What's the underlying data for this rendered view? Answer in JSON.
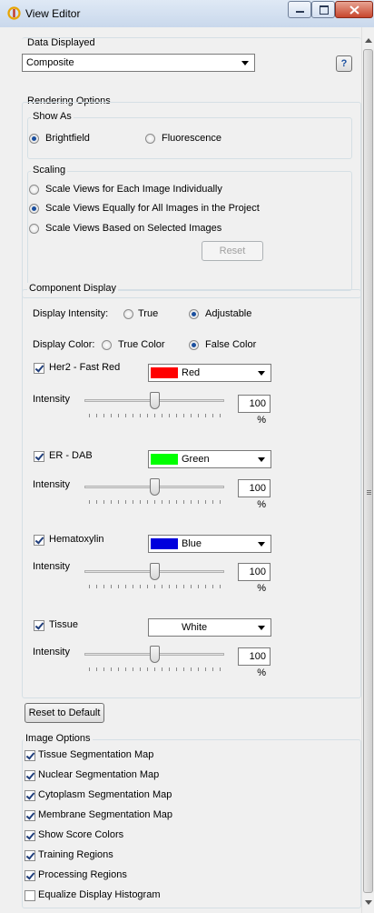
{
  "window": {
    "title": "View Editor"
  },
  "data_displayed": {
    "label": "Data Displayed",
    "selected": "Composite",
    "help_label": "?"
  },
  "rendering_options": {
    "label": "Rendering Options",
    "show_as": {
      "label": "Show As",
      "options": [
        "Brightfield",
        "Fluorescence"
      ],
      "selected": "Brightfield"
    },
    "scaling": {
      "label": "Scaling",
      "options": [
        "Scale Views for Each Image Individually",
        "Scale Views Equally for All Images in the Project",
        "Scale Views Based on Selected Images"
      ],
      "selected": "Scale Views Equally for All Images in the Project",
      "reset_label": "Reset"
    }
  },
  "component_display": {
    "label": "Component Display",
    "display_intensity": {
      "label": "Display Intensity:",
      "options": [
        "True",
        "Adjustable"
      ],
      "selected": "Adjustable"
    },
    "display_color": {
      "label": "Display Color:",
      "options": [
        "True Color",
        "False Color"
      ],
      "selected": "False Color"
    },
    "intensity_label": "Intensity",
    "components": [
      {
        "name": "Her2 - Fast Red",
        "checked": true,
        "color_name": "Red",
        "color": "#ff0000",
        "intensity": "100 %",
        "slider_level": 0.5
      },
      {
        "name": "ER - DAB",
        "checked": true,
        "color_name": "Green",
        "color": "#00ff00",
        "intensity": "100 %",
        "slider_level": 0.5
      },
      {
        "name": "Hematoxylin",
        "checked": true,
        "color_name": "Blue",
        "color": "#0000dd",
        "intensity": "100 %",
        "slider_level": 0.5
      },
      {
        "name": "Tissue",
        "checked": true,
        "color_name": "White",
        "color": "#ffffff",
        "intensity": "100 %",
        "slider_level": 0.5
      }
    ]
  },
  "reset_default_label": "Reset to Default",
  "image_options": {
    "label": "Image Options",
    "items": [
      {
        "label": "Tissue Segmentation Map",
        "checked": true
      },
      {
        "label": "Nuclear Segmentation Map",
        "checked": true
      },
      {
        "label": "Cytoplasm Segmentation Map",
        "checked": true
      },
      {
        "label": "Membrane Segmentation Map",
        "checked": true
      },
      {
        "label": "Show Score Colors",
        "checked": true
      },
      {
        "label": "Training Regions",
        "checked": true
      },
      {
        "label": "Processing Regions",
        "checked": true
      },
      {
        "label": "Equalize Display Histogram",
        "checked": false
      }
    ]
  }
}
